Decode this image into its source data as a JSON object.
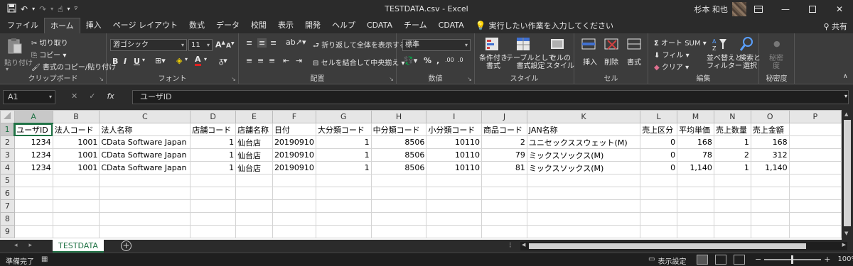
{
  "title_bar": {
    "document_title": "TESTDATA.csv  -  Excel",
    "user_name": "杉本 和也"
  },
  "tabs": [
    "ファイル",
    "ホーム",
    "挿入",
    "ページ レイアウト",
    "数式",
    "データ",
    "校閲",
    "表示",
    "開発",
    "ヘルプ",
    "CDATA",
    "チーム",
    "CDATA"
  ],
  "active_tab": "ホーム",
  "tell_me": "実行したい作業を入力してください",
  "share_label": "共有",
  "ribbon": {
    "clipboard": {
      "label": "クリップボード",
      "paste": "貼り付け",
      "cut": "切り取り",
      "copy": "コピー",
      "format_painter": "書式のコピー/貼り付け"
    },
    "font": {
      "label": "フォント",
      "font_name": "游ゴシック",
      "font_size": "11"
    },
    "alignment": {
      "label": "配置",
      "wrap_text": "折り返して全体を表示する",
      "merge_center": "セルを結合して中央揃え"
    },
    "number": {
      "label": "数値",
      "format": "標準"
    },
    "styles": {
      "label": "スタイル",
      "conditional": "条件付き\n書式",
      "table": "テーブルとして\n書式設定",
      "cell_styles": "セルの\nスタイル"
    },
    "cells": {
      "label": "セル",
      "insert": "挿入",
      "delete": "削除",
      "format": "書式"
    },
    "editing": {
      "label": "編集",
      "autosum": "オート SUM",
      "fill": "フィル",
      "clear": "クリア",
      "sort_filter": "並べ替えと\nフィルター",
      "find_select": "検索と\n選択"
    },
    "sensitivity": {
      "label": "秘密度",
      "button": "秘密\n度"
    }
  },
  "formula_bar": {
    "name_box": "A1",
    "content": "ユーザID"
  },
  "sheet": {
    "columns": [
      "A",
      "B",
      "C",
      "D",
      "E",
      "F",
      "G",
      "H",
      "I",
      "J",
      "K",
      "L",
      "M",
      "N",
      "O",
      "P"
    ],
    "row_numbers": [
      "1",
      "2",
      "3",
      "4",
      "5",
      "6",
      "7",
      "8",
      "9"
    ],
    "rows": [
      [
        "ユーザID",
        "法人コード",
        "法人名称",
        "店舗コード",
        "店舗名称",
        "日付",
        "大分類コード",
        "中分類コード",
        "小分類コード",
        "商品コード",
        "JAN名称",
        "売上区分",
        "平均単価",
        "売上数量",
        "売上金額",
        ""
      ],
      [
        "1234",
        "1001",
        "CData Software Japan",
        "1",
        "仙台店",
        "20190910",
        "1",
        "8506",
        "10110",
        "2",
        "ユニセックススウェット(M)",
        "0",
        "168",
        "1",
        "168",
        ""
      ],
      [
        "1234",
        "1001",
        "CData Software Japan",
        "1",
        "仙台店",
        "20190910",
        "1",
        "8506",
        "10110",
        "79",
        "ミックスソックス(M)",
        "0",
        "78",
        "2",
        "312",
        ""
      ],
      [
        "1234",
        "1001",
        "CData Software Japan",
        "1",
        "仙台店",
        "20190910",
        "1",
        "8506",
        "10110",
        "81",
        "ミックスソックス(M)",
        "0",
        "1,140",
        "1",
        "1,140",
        ""
      ],
      [
        "",
        "",
        "",
        "",
        "",
        "",
        "",
        "",
        "",
        "",
        "",
        "",
        "",
        "",
        "",
        ""
      ],
      [
        "",
        "",
        "",
        "",
        "",
        "",
        "",
        "",
        "",
        "",
        "",
        "",
        "",
        "",
        "",
        ""
      ],
      [
        "",
        "",
        "",
        "",
        "",
        "",
        "",
        "",
        "",
        "",
        "",
        "",
        "",
        "",
        "",
        ""
      ],
      [
        "",
        "",
        "",
        "",
        "",
        "",
        "",
        "",
        "",
        "",
        "",
        "",
        "",
        "",
        "",
        ""
      ],
      [
        "",
        "",
        "",
        "",
        "",
        "",
        "",
        "",
        "",
        "",
        "",
        "",
        "",
        "",
        "",
        ""
      ]
    ]
  },
  "sheet_tab": "TESTDATA",
  "status": {
    "ready": "準備完了",
    "display_settings": "表示設定",
    "zoom": "100%"
  }
}
